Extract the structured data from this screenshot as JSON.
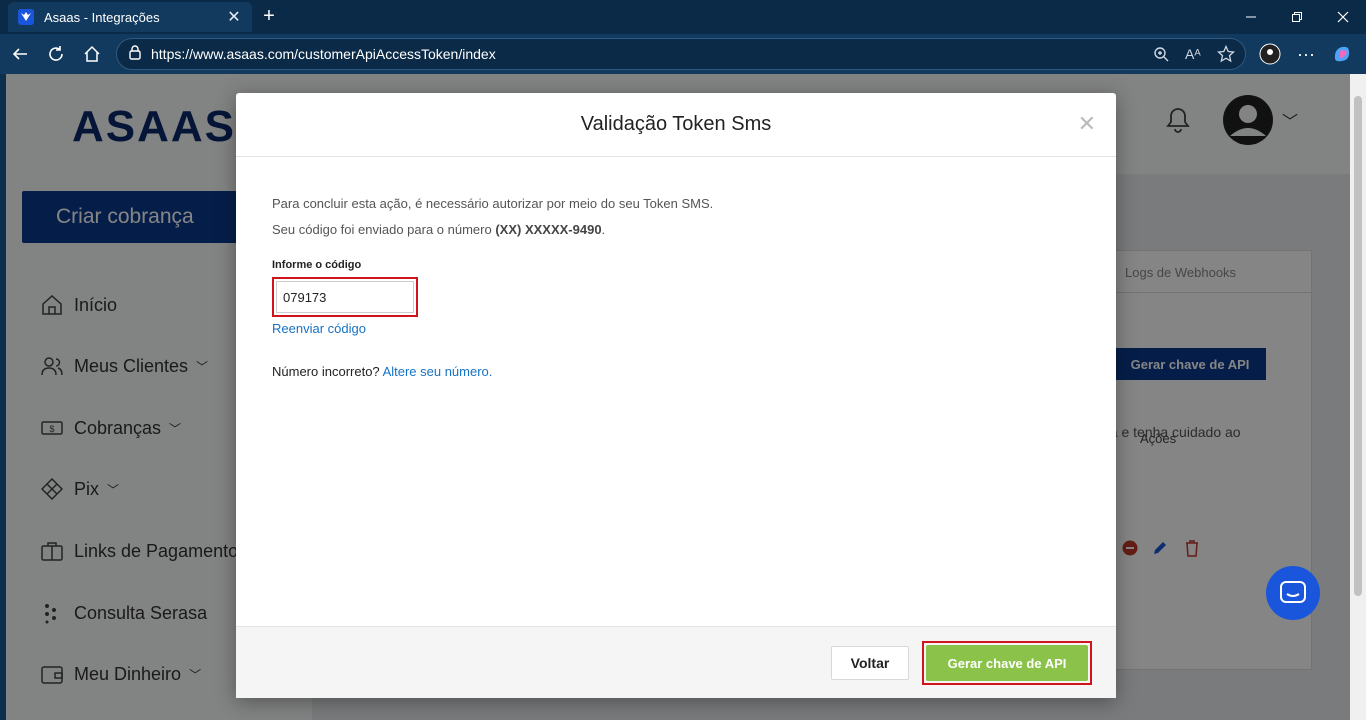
{
  "browser": {
    "tab_title": "Asaas - Integrações",
    "url": "https://www.asaas.com/customerApiAccessToken/index"
  },
  "sidebar": {
    "logo": "ASAAS",
    "cta": "Criar cobrança",
    "items": [
      {
        "label": "Início",
        "icon": "home-icon"
      },
      {
        "label": "Meus Clientes",
        "icon": "users-icon"
      },
      {
        "label": "Cobranças",
        "icon": "money-icon"
      },
      {
        "label": "Pix",
        "icon": "pix-icon"
      },
      {
        "label": "Links de Pagamento",
        "icon": "briefcase-icon"
      },
      {
        "label": "Consulta Serasa",
        "icon": "serasa-icon"
      },
      {
        "label": "Meu Dinheiro",
        "icon": "wallet-icon"
      }
    ]
  },
  "background": {
    "tab_webhooks": "Logs de Webhooks",
    "generate_button": "Gerar chave de API",
    "warning_fragment": "na e tenha cuidado ao",
    "actions_header": "Ações"
  },
  "modal": {
    "title": "Validação Token Sms",
    "line1": "Para concluir esta ação, é necessário autorizar por meio do seu Token SMS.",
    "line2_prefix": "Seu código foi enviado para o número ",
    "line2_number": "(XX) XXXXX-9490",
    "line2_suffix": ".",
    "code_label": "Informe o código",
    "code_value": "079173",
    "resend": "Reenviar código",
    "wrong_number_prefix": "Número incorreto? ",
    "wrong_number_link": "Altere seu número.",
    "back_button": "Voltar",
    "generate_button": "Gerar chave de API"
  },
  "colors": {
    "primary": "#0b3b8c",
    "accent_green": "#8bc34a",
    "highlight_red": "#d0141c",
    "link": "#1673c5"
  }
}
